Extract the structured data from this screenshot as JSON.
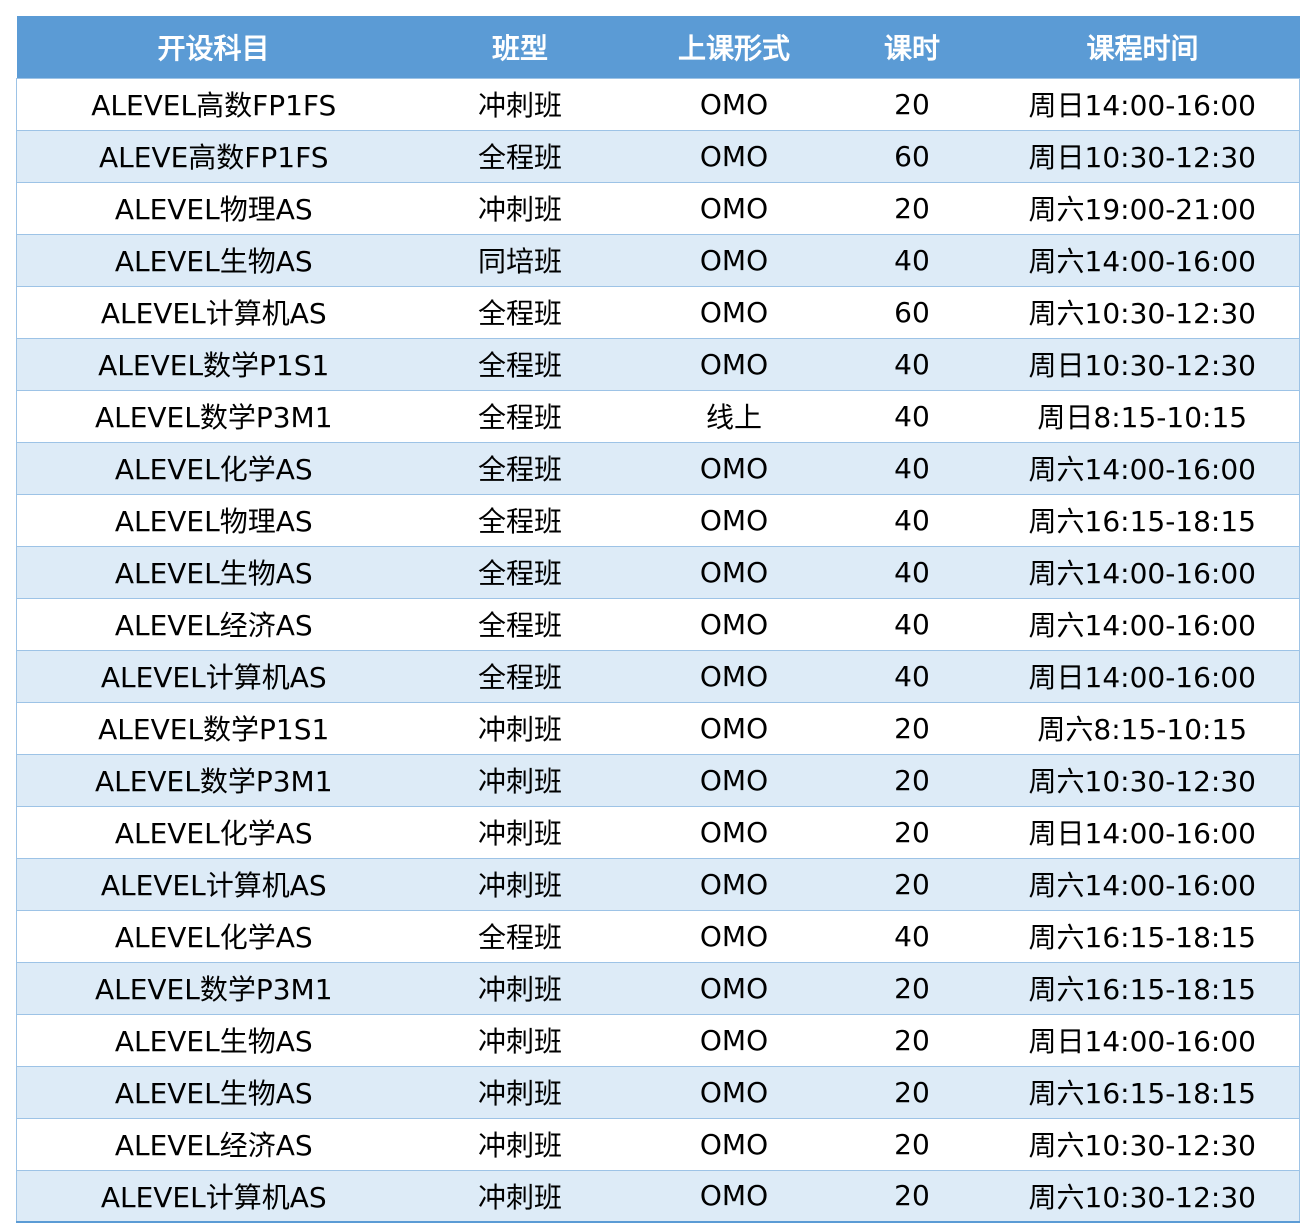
{
  "table": {
    "headers": [
      "开设科目",
      "班型",
      "上课形式",
      "课时",
      "课程时间"
    ],
    "rows": [
      [
        "ALEVEL高数FP1FS",
        "冲刺班",
        "OMO",
        "20",
        "周日14:00-16:00"
      ],
      [
        "ALEVE高数FP1FS",
        "全程班",
        "OMO",
        "60",
        "周日10:30-12:30"
      ],
      [
        "ALEVEL物理AS",
        "冲刺班",
        "OMO",
        "20",
        "周六19:00-21:00"
      ],
      [
        "ALEVEL生物AS",
        "同培班",
        "OMO",
        "40",
        "周六14:00-16:00"
      ],
      [
        "ALEVEL计算机AS",
        "全程班",
        "OMO",
        "60",
        "周六10:30-12:30"
      ],
      [
        "ALEVEL数学P1S1",
        "全程班",
        "OMO",
        "40",
        "周日10:30-12:30"
      ],
      [
        "ALEVEL数学P3M1",
        "全程班",
        "线上",
        "40",
        "周日8:15-10:15"
      ],
      [
        "ALEVEL化学AS",
        "全程班",
        "OMO",
        "40",
        "周六14:00-16:00"
      ],
      [
        "ALEVEL物理AS",
        "全程班",
        "OMO",
        "40",
        "周六16:15-18:15"
      ],
      [
        "ALEVEL生物AS",
        "全程班",
        "OMO",
        "40",
        "周六14:00-16:00"
      ],
      [
        "ALEVEL经济AS",
        "全程班",
        "OMO",
        "40",
        "周六14:00-16:00"
      ],
      [
        "ALEVEL计算机AS",
        "全程班",
        "OMO",
        "40",
        "周日14:00-16:00"
      ],
      [
        "ALEVEL数学P1S1",
        "冲刺班",
        "OMO",
        "20",
        "周六8:15-10:15"
      ],
      [
        "ALEVEL数学P3M1",
        "冲刺班",
        "OMO",
        "20",
        "周六10:30-12:30"
      ],
      [
        "ALEVEL化学AS",
        "冲刺班",
        "OMO",
        "20",
        "周日14:00-16:00"
      ],
      [
        "ALEVEL计算机AS",
        "冲刺班",
        "OMO",
        "20",
        "周六14:00-16:00"
      ],
      [
        "ALEVEL化学AS",
        "全程班",
        "OMO",
        "40",
        "周六16:15-18:15"
      ],
      [
        "ALEVEL数学P3M1",
        "冲刺班",
        "OMO",
        "20",
        "周六16:15-18:15"
      ],
      [
        "ALEVEL生物AS",
        "冲刺班",
        "OMO",
        "20",
        "周日14:00-16:00"
      ],
      [
        "ALEVEL生物AS",
        "冲刺班",
        "OMO",
        "20",
        "周六16:15-18:15"
      ],
      [
        "ALEVEL经济AS",
        "冲刺班",
        "OMO",
        "20",
        "周六10:30-12:30"
      ],
      [
        "ALEVEL计算机AS",
        "冲刺班",
        "OMO",
        "20",
        "周六10:30-12:30"
      ]
    ]
  },
  "colors": {
    "header_bg": "#5b9bd5",
    "header_text": "#ffffff",
    "row_alt_bg": "#ddebf7",
    "row_bg": "#ffffff",
    "grid": "#9dc3e6"
  }
}
